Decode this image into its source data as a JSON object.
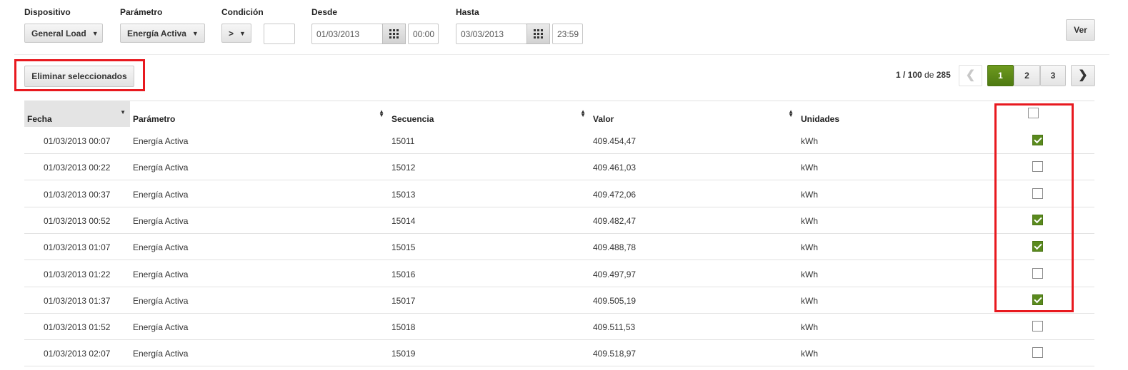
{
  "filters": {
    "dispositivo": {
      "label": "Dispositivo",
      "value": "General Load"
    },
    "parametro": {
      "label": "Parámetro",
      "value": "Energía Activa"
    },
    "condicion": {
      "label": "Condición",
      "operator": ">",
      "value": ""
    },
    "desde": {
      "label": "Desde",
      "date": "01/03/2013",
      "time": "00:00"
    },
    "hasta": {
      "label": "Hasta",
      "date": "03/03/2013",
      "time": "23:59"
    },
    "ver_label": "Ver",
    "calendar_icon": "calendar-grid-icon"
  },
  "actions": {
    "delete_selected_label": "Eliminar seleccionados"
  },
  "pagination": {
    "range": "1 / 100",
    "of": "de",
    "total": "285",
    "pages": [
      "1",
      "2",
      "3"
    ],
    "current_page": "1",
    "prev_icon": "chevron-left-icon",
    "next_icon": "chevron-right-icon"
  },
  "table": {
    "columns": [
      "Fecha",
      "Parámetro",
      "Secuencia",
      "Valor",
      "Unidades"
    ],
    "rows": [
      {
        "fecha": "01/03/2013 00:07",
        "parametro": "Energía Activa",
        "secuencia": "15011",
        "valor": "409.454,47",
        "unidades": "kWh",
        "checked": true
      },
      {
        "fecha": "01/03/2013 00:22",
        "parametro": "Energía Activa",
        "secuencia": "15012",
        "valor": "409.461,03",
        "unidades": "kWh",
        "checked": false
      },
      {
        "fecha": "01/03/2013 00:37",
        "parametro": "Energía Activa",
        "secuencia": "15013",
        "valor": "409.472,06",
        "unidades": "kWh",
        "checked": false
      },
      {
        "fecha": "01/03/2013 00:52",
        "parametro": "Energía Activa",
        "secuencia": "15014",
        "valor": "409.482,47",
        "unidades": "kWh",
        "checked": true
      },
      {
        "fecha": "01/03/2013 01:07",
        "parametro": "Energía Activa",
        "secuencia": "15015",
        "valor": "409.488,78",
        "unidades": "kWh",
        "checked": true
      },
      {
        "fecha": "01/03/2013 01:22",
        "parametro": "Energía Activa",
        "secuencia": "15016",
        "valor": "409.497,97",
        "unidades": "kWh",
        "checked": false
      },
      {
        "fecha": "01/03/2013 01:37",
        "parametro": "Energía Activa",
        "secuencia": "15017",
        "valor": "409.505,19",
        "unidades": "kWh",
        "checked": true
      },
      {
        "fecha": "01/03/2013 01:52",
        "parametro": "Energía Activa",
        "secuencia": "15018",
        "valor": "409.511,53",
        "unidades": "kWh",
        "checked": false
      },
      {
        "fecha": "01/03/2013 02:07",
        "parametro": "Energía Activa",
        "secuencia": "15019",
        "valor": "409.518,97",
        "unidades": "kWh",
        "checked": false
      }
    ]
  },
  "colors": {
    "accent_green": "#5a8a1e",
    "highlight_red": "#e8191f",
    "sorted_header_bg": "#e4e4e4"
  }
}
